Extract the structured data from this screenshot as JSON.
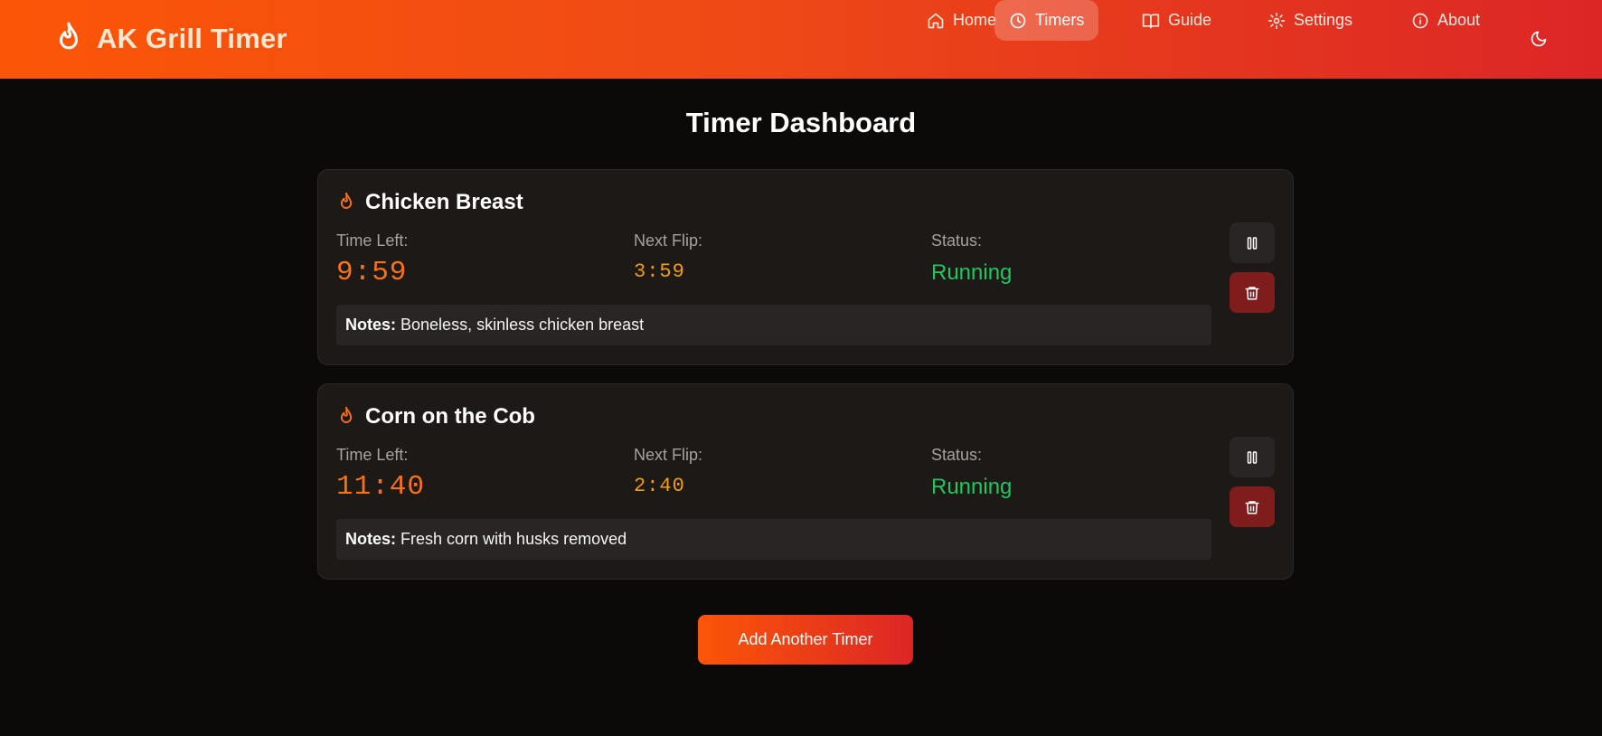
{
  "brand": {
    "title": "AK Grill Timer",
    "icon": "flame-icon"
  },
  "nav": {
    "items": [
      {
        "label": "Home",
        "icon": "home-icon"
      },
      {
        "label": "Timers",
        "icon": "clock-icon",
        "active": true
      },
      {
        "label": "Guide",
        "icon": "book-icon"
      },
      {
        "label": "Settings",
        "icon": "gear-icon"
      },
      {
        "label": "About",
        "icon": "info-icon"
      }
    ],
    "theme_toggle_icon": "moon-icon"
  },
  "page": {
    "title": "Timer Dashboard"
  },
  "labels": {
    "time_left": "Time Left:",
    "next_flip": "Next Flip:",
    "status": "Status:",
    "notes": "Notes:"
  },
  "timers": [
    {
      "name": "Chicken Breast",
      "time_left": "9:59",
      "next_flip": "3:59",
      "status": "Running",
      "notes": "Boneless, skinless chicken breast"
    },
    {
      "name": "Corn on the Cob",
      "time_left": "11:40",
      "next_flip": "2:40",
      "status": "Running",
      "notes": "Fresh corn with husks removed"
    }
  ],
  "actions": {
    "add_timer_label": "Add Another Timer"
  },
  "colors": {
    "header_gradient_start": "#fb5607",
    "header_gradient_end": "#dc2626",
    "time_left": "#f97316",
    "next_flip": "#f59e0b",
    "status_running": "#22c55e",
    "delete_button": "#7f1d1d",
    "background": "#0c0a09",
    "card": "#1c1917"
  }
}
